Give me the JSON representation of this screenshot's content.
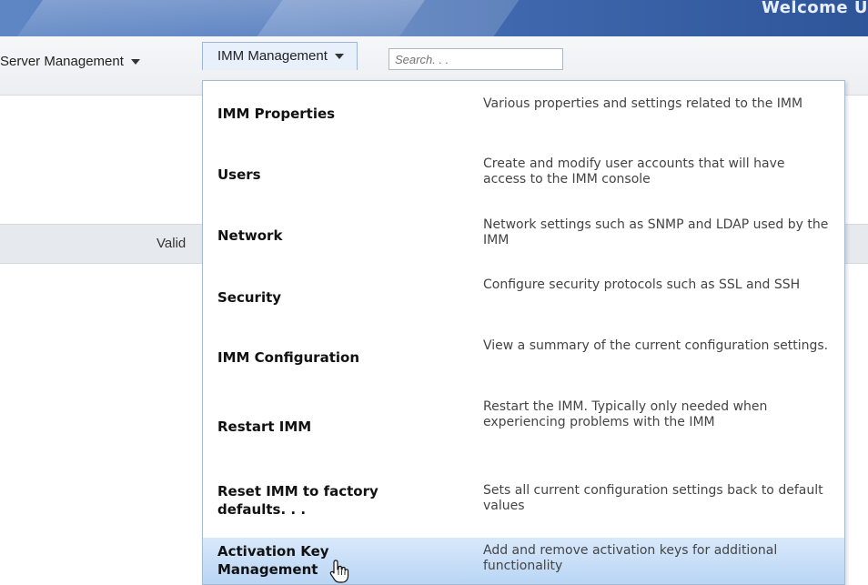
{
  "banner": {
    "welcome_text": "Welcome U"
  },
  "nav": {
    "server_management": "Server Management",
    "imm_management": "IMM Management",
    "search_placeholder": "Search. . ."
  },
  "table": {
    "valid_header": "Valid"
  },
  "menu": {
    "items": [
      {
        "title": "IMM Properties",
        "desc": "Various properties and settings related to the IMM"
      },
      {
        "title": "Users",
        "desc": "Create and modify user accounts that will have access to the IMM console"
      },
      {
        "title": "Network",
        "desc": "Network settings such as SNMP and LDAP used by the IMM"
      },
      {
        "title": "Security",
        "desc": "Configure security protocols such as SSL and SSH"
      },
      {
        "title": "IMM Configuration",
        "desc": "View a summary of the current configuration settings."
      },
      {
        "title": "Restart IMM",
        "desc": "Restart the IMM. Typically only needed when experiencing problems with the IMM"
      },
      {
        "title": "Reset IMM to factory defaults. . .",
        "desc": "Sets all current configuration settings back to default values"
      },
      {
        "title": "Activation Key Management",
        "desc": "Add and remove activation keys for additional functionality"
      }
    ]
  },
  "colors": {
    "accent_selected": "#b9d5f4",
    "banner": "#4f79bd"
  }
}
